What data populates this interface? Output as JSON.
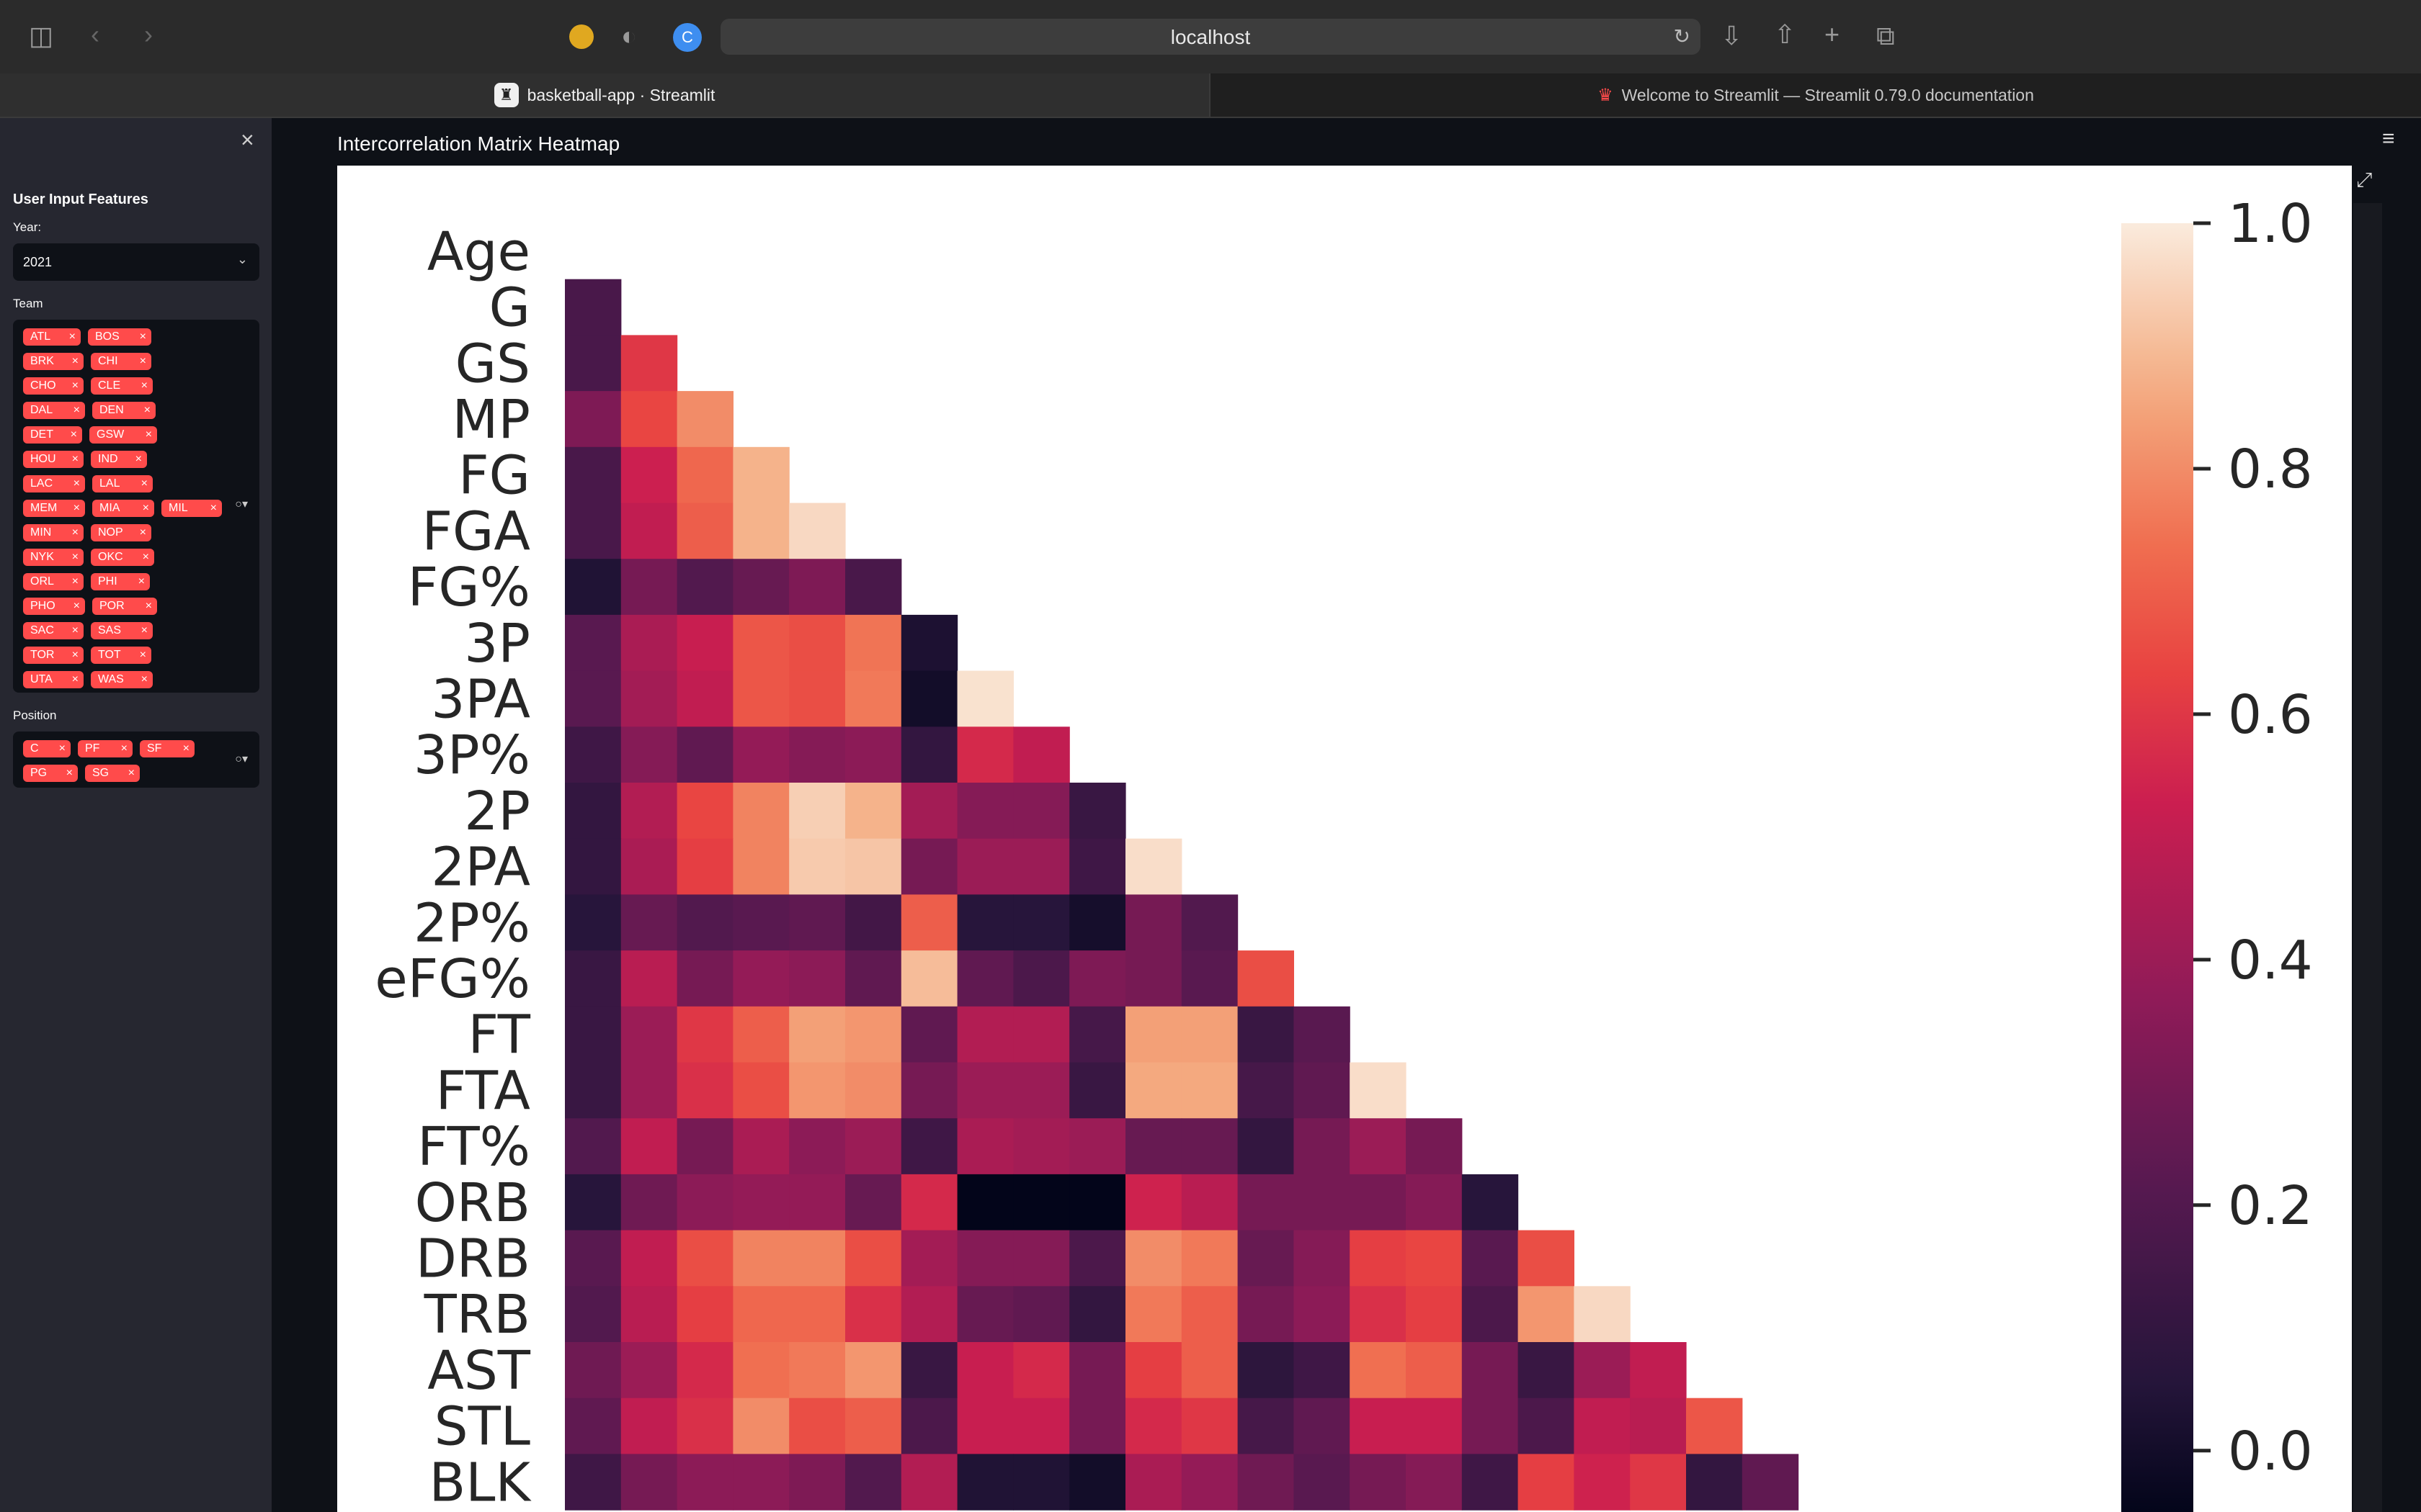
{
  "browser": {
    "url": "localhost",
    "tabs": [
      {
        "label": "basketball-app · Streamlit"
      },
      {
        "label": "Welcome to Streamlit — Streamlit 0.79.0 documentation"
      }
    ]
  },
  "sidebar": {
    "title": "User Input Features",
    "year_label": "Year:",
    "year_value": "2021",
    "team_label": "Team",
    "teams": [
      "ATL",
      "BOS",
      "BRK",
      "CHI",
      "CHO",
      "CLE",
      "DAL",
      "DEN",
      "DET",
      "GSW",
      "HOU",
      "IND",
      "LAC",
      "LAL",
      "MEM",
      "MIA",
      "MIL",
      "MIN",
      "NOP",
      "NYK",
      "OKC",
      "ORL",
      "PHI",
      "PHO",
      "POR",
      "SAC",
      "SAS",
      "TOR",
      "TOT",
      "UTA",
      "WAS"
    ],
    "position_label": "Position",
    "positions": [
      "C",
      "PF",
      "SF",
      "PG",
      "SG"
    ]
  },
  "main": {
    "title": "Intercorrelation Matrix Heatmap"
  },
  "chart_data": {
    "type": "heatmap",
    "title": "",
    "xlabel": "",
    "ylabel": "",
    "row_labels": [
      "Age",
      "G",
      "GS",
      "MP",
      "FG",
      "FGA",
      "FG%",
      "3P",
      "3PA",
      "3P%",
      "2P",
      "2PA",
      "2P%",
      "eFG%",
      "FT",
      "FTA",
      "FT%",
      "ORB",
      "DRB",
      "TRB",
      "AST",
      "STL",
      "BLK"
    ],
    "colorbar_ticks": [
      "1.0",
      "0.8",
      "0.6",
      "0.4",
      "0.2",
      "0.0"
    ],
    "vmin": -0.05,
    "vmax": 1.0,
    "colormap": "rocket",
    "mask": "upper triangle (including diagonal)",
    "values": [
      [],
      [
        0.17
      ],
      [
        0.17,
        0.6
      ],
      [
        0.32,
        0.64,
        0.8
      ],
      [
        0.17,
        0.53,
        0.72,
        0.88
      ],
      [
        0.17,
        0.5,
        0.7,
        0.88,
        0.96
      ],
      [
        0.04,
        0.3,
        0.2,
        0.26,
        0.32,
        0.17
      ],
      [
        0.22,
        0.44,
        0.52,
        0.68,
        0.66,
        0.75,
        0.03
      ],
      [
        0.22,
        0.42,
        0.5,
        0.68,
        0.66,
        0.76,
        0.0,
        0.98
      ],
      [
        0.14,
        0.34,
        0.24,
        0.38,
        0.34,
        0.36,
        0.1,
        0.56,
        0.5
      ],
      [
        0.1,
        0.46,
        0.64,
        0.78,
        0.94,
        0.88,
        0.42,
        0.34,
        0.34,
        0.12
      ],
      [
        0.1,
        0.44,
        0.62,
        0.78,
        0.93,
        0.92,
        0.3,
        0.4,
        0.4,
        0.14,
        0.97
      ],
      [
        0.06,
        0.26,
        0.2,
        0.22,
        0.24,
        0.15,
        0.7,
        0.06,
        0.06,
        0.01,
        0.3,
        0.2
      ],
      [
        0.12,
        0.48,
        0.3,
        0.38,
        0.36,
        0.24,
        0.9,
        0.24,
        0.18,
        0.32,
        0.3,
        0.22,
        0.66
      ],
      [
        0.12,
        0.4,
        0.6,
        0.7,
        0.84,
        0.82,
        0.24,
        0.46,
        0.46,
        0.16,
        0.84,
        0.84,
        0.12,
        0.22
      ],
      [
        0.12,
        0.4,
        0.58,
        0.66,
        0.82,
        0.8,
        0.3,
        0.4,
        0.4,
        0.12,
        0.86,
        0.86,
        0.16,
        0.24,
        0.97
      ],
      [
        0.2,
        0.5,
        0.3,
        0.44,
        0.36,
        0.4,
        0.14,
        0.44,
        0.42,
        0.4,
        0.26,
        0.26,
        0.1,
        0.3,
        0.4,
        0.3
      ],
      [
        0.06,
        0.28,
        0.36,
        0.38,
        0.38,
        0.26,
        0.56,
        -0.05,
        -0.05,
        -0.1,
        0.54,
        0.48,
        0.3,
        0.3,
        0.3,
        0.34,
        0.06
      ],
      [
        0.22,
        0.5,
        0.66,
        0.78,
        0.78,
        0.66,
        0.42,
        0.34,
        0.34,
        0.18,
        0.8,
        0.76,
        0.26,
        0.34,
        0.62,
        0.64,
        0.22,
        0.66
      ],
      [
        0.2,
        0.48,
        0.62,
        0.72,
        0.72,
        0.58,
        0.46,
        0.26,
        0.24,
        0.1,
        0.76,
        0.7,
        0.3,
        0.36,
        0.58,
        0.62,
        0.18,
        0.82,
        0.96
      ],
      [
        0.28,
        0.4,
        0.56,
        0.74,
        0.76,
        0.82,
        0.12,
        0.52,
        0.56,
        0.3,
        0.62,
        0.7,
        0.08,
        0.14,
        0.74,
        0.7,
        0.3,
        0.12,
        0.4,
        0.5
      ],
      [
        0.24,
        0.5,
        0.58,
        0.8,
        0.66,
        0.7,
        0.18,
        0.52,
        0.52,
        0.3,
        0.56,
        0.6,
        0.16,
        0.24,
        0.52,
        0.52,
        0.3,
        0.18,
        0.5,
        0.48,
        0.68
      ],
      [
        0.14,
        0.3,
        0.36,
        0.36,
        0.32,
        0.2,
        0.46,
        0.04,
        0.04,
        0.0,
        0.44,
        0.38,
        0.28,
        0.22,
        0.3,
        0.34,
        0.14,
        0.62,
        0.54,
        0.6,
        0.1,
        0.24
      ]
    ]
  }
}
